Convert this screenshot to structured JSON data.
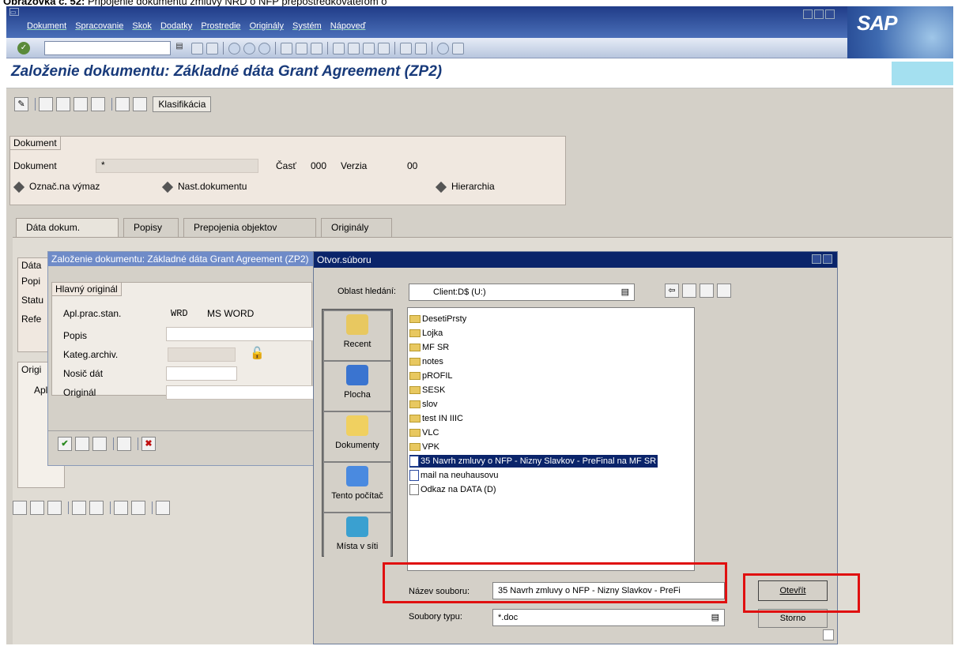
{
  "caption": {
    "prefix": "Obrazovka č. 52:",
    "text": " Pripojenie dokumentu zmluvy NRD o NFP prepostredkovateľom o"
  },
  "menu": [
    "Dokument",
    "Spracovanie",
    "Skok",
    "Dodatky",
    "Prostredie",
    "Originály",
    "Systém",
    "Nápoveď"
  ],
  "logo": "SAP",
  "window_title": "Založenie dokumentu: Základné dáta Grant Agreement (ZP2)",
  "toolbar2": {
    "klasifikacia": "Klasifikácia"
  },
  "dokument_group": {
    "title": "Dokument",
    "dokument_label": "Dokument",
    "dokument_value": "*",
    "cast_label": "Časť",
    "cast_value": "000",
    "verzia_label": "Verzia",
    "verzia_value": "00",
    "oznac": "Označ.na výmaz",
    "nast": "Nast.dokumentu",
    "hierarchia": "Hierarchia"
  },
  "tabs": [
    "Dáta dokum.",
    "Popisy",
    "Prepojenia objektov",
    "Originály"
  ],
  "behind": {
    "data": "Dáta",
    "popis": "Popi",
    "status": "Statu",
    "refe": "Refe",
    "origi": "Origi",
    "apl": "Apl"
  },
  "dialog1": {
    "title": "Založenie dokumentu: Základné dáta Grant Agreement (ZP2)",
    "group": "Hlavný originál",
    "apl_label": "Apl.prac.stan.",
    "apl_code": "WRD",
    "apl_value": "MS WORD",
    "popis": "Popis",
    "kateg": "Kateg.archiv.",
    "nosic": "Nosič dát",
    "original": "Originál"
  },
  "dialog2": {
    "title": "Otvor.súboru",
    "oblast_label": "Oblast hledání:",
    "oblast_value": "Client:D$ (U:)",
    "places": [
      "Recent",
      "Plocha",
      "Dokumenty",
      "Tento počítač",
      "Místa v síti"
    ],
    "files": [
      {
        "name": "DesetiPrsty",
        "type": "folder"
      },
      {
        "name": "Lojka",
        "type": "folder"
      },
      {
        "name": "MF SR",
        "type": "folder"
      },
      {
        "name": "notes",
        "type": "folder"
      },
      {
        "name": "pROFIL",
        "type": "folder"
      },
      {
        "name": "SESK",
        "type": "folder"
      },
      {
        "name": "slov",
        "type": "folder"
      },
      {
        "name": "test IN IIIC",
        "type": "folder"
      },
      {
        "name": "VLC",
        "type": "folder"
      },
      {
        "name": "VPK",
        "type": "folder"
      },
      {
        "name": "35 Navrh zmluvy o NFP - Nizny Slavkov - PreFinal na MF SR",
        "type": "doc"
      },
      {
        "name": "mail na neuhausovu",
        "type": "doc"
      },
      {
        "name": "Odkaz na DATA (D)",
        "type": "link"
      }
    ],
    "nazev_label": "Název souboru:",
    "nazev_value": "35 Navrh zmluvy o NFP - Nizny Slavkov - PreFi",
    "typ_label": "Soubory typu:",
    "typ_value": "*.doc",
    "otevrit": "Otevřít",
    "storno": "Storno"
  }
}
